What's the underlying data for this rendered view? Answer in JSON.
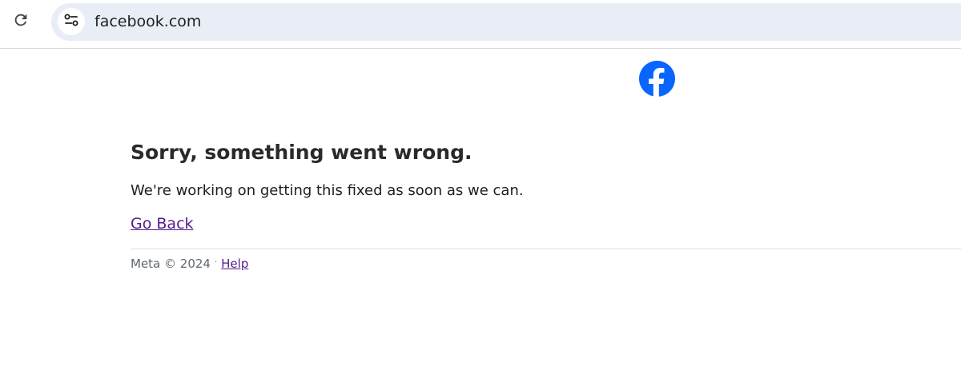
{
  "browser": {
    "url": "facebook.com"
  },
  "icons": {
    "reload": "reload-icon",
    "site_info": "site-info-icon",
    "logo": "facebook-logo"
  },
  "colors": {
    "brand": "#0866ff",
    "link_visited": "#551a8b",
    "omnibox_bg": "#e9eef6"
  },
  "error": {
    "title": "Sorry, something went wrong.",
    "message": "We're working on getting this fixed as soon as we can.",
    "go_back": "Go Back"
  },
  "footer": {
    "copyright": "Meta © 2024",
    "separator": "·",
    "help": "Help"
  }
}
